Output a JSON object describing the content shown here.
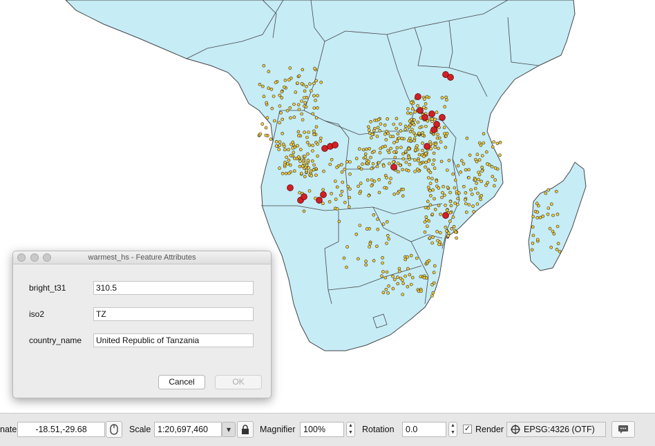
{
  "colors": {
    "land": "#c6ecf6",
    "border": "#444444",
    "point_small": "#f5cf3a",
    "point_hot": "#d21f24"
  },
  "dialog": {
    "title": "warmest_hs - Feature Attributes",
    "fields": [
      {
        "label": "bright_t31",
        "value": "310.5"
      },
      {
        "label": "iso2",
        "value": "TZ"
      },
      {
        "label": "country_name",
        "value": "United Republic of Tanzania"
      }
    ],
    "cancel_label": "Cancel",
    "ok_label": "OK"
  },
  "statusbar": {
    "coordinate_label": "nate",
    "coordinate_value": "-18.51,-29.68",
    "scale_label": "Scale",
    "scale_value": "1:20,697,460",
    "magnifier_label": "Magnifier",
    "magnifier_value": "100%",
    "rotation_label": "Rotation",
    "rotation_value": "0.0",
    "render_label": "Render",
    "render_checked": true,
    "crs_label": "EPSG:4326 (OTF)",
    "icons": [
      "mouse-icon",
      "lock-icon",
      "globe-icon",
      "messages-icon"
    ]
  }
}
